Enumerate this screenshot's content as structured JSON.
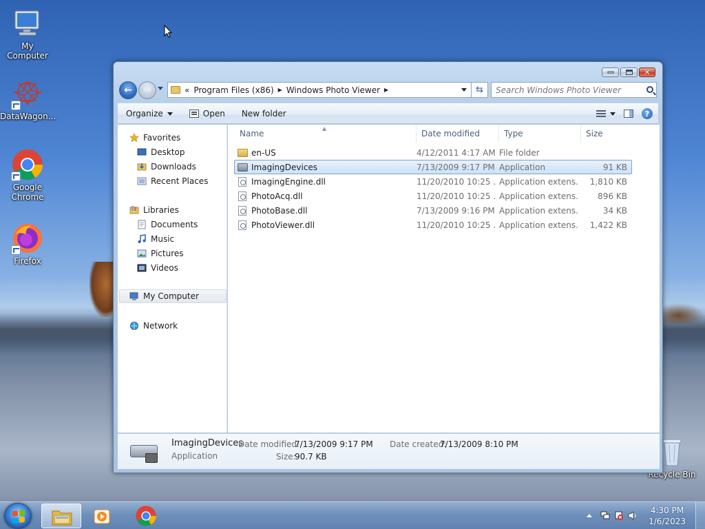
{
  "desktop": {
    "icons": [
      {
        "label": "My Computer"
      },
      {
        "label": "DataWagon..."
      },
      {
        "label": "Google Chrome"
      },
      {
        "label": "Firefox"
      },
      {
        "label": "Recycle Bin"
      }
    ]
  },
  "window": {
    "address": {
      "overflow": "«",
      "parts": [
        "Program Files (x86)",
        "Windows Photo Viewer"
      ]
    },
    "search_placeholder": "Search Windows Photo Viewer",
    "toolbar": {
      "organize": "Organize",
      "open": "Open",
      "new_folder": "New folder"
    },
    "navpane": {
      "favorites": "Favorites",
      "favorites_items": [
        "Desktop",
        "Downloads",
        "Recent Places"
      ],
      "libraries": "Libraries",
      "libraries_items": [
        "Documents",
        "Music",
        "Pictures",
        "Videos"
      ],
      "computer": "My Computer",
      "network": "Network"
    },
    "columns": {
      "name": "Name",
      "date": "Date modified",
      "type": "Type",
      "size": "Size"
    },
    "files": [
      {
        "name": "en-US",
        "date": "4/12/2011 4:17 AM",
        "type": "File folder",
        "size": "",
        "icon": "folder-icon"
      },
      {
        "name": "ImagingDevices",
        "date": "7/13/2009 9:17 PM",
        "type": "Application",
        "size": "91 KB",
        "icon": "application-icon",
        "selected": true
      },
      {
        "name": "ImagingEngine.dll",
        "date": "11/20/2010 10:25 ...",
        "type": "Application extens...",
        "size": "1,810 KB",
        "icon": "dll-file-icon"
      },
      {
        "name": "PhotoAcq.dll",
        "date": "11/20/2010 10:25 ...",
        "type": "Application extens...",
        "size": "896 KB",
        "icon": "dll-file-icon"
      },
      {
        "name": "PhotoBase.dll",
        "date": "7/13/2009 9:16 PM",
        "type": "Application extens...",
        "size": "34 KB",
        "icon": "dll-file-icon"
      },
      {
        "name": "PhotoViewer.dll",
        "date": "11/20/2010 10:25 ...",
        "type": "Application extens...",
        "size": "1,422 KB",
        "icon": "dll-file-icon"
      }
    ],
    "details": {
      "name": "ImagingDevices",
      "type": "Application",
      "modified_label": "Date modified:",
      "modified_value": "7/13/2009 9:17 PM",
      "created_label": "Date created:",
      "created_value": "7/13/2009 8:10 PM",
      "size_label": "Size:",
      "size_value": "90.7 KB"
    }
  },
  "taskbar": {
    "time": "4:30 PM",
    "date": "1/6/2023"
  }
}
